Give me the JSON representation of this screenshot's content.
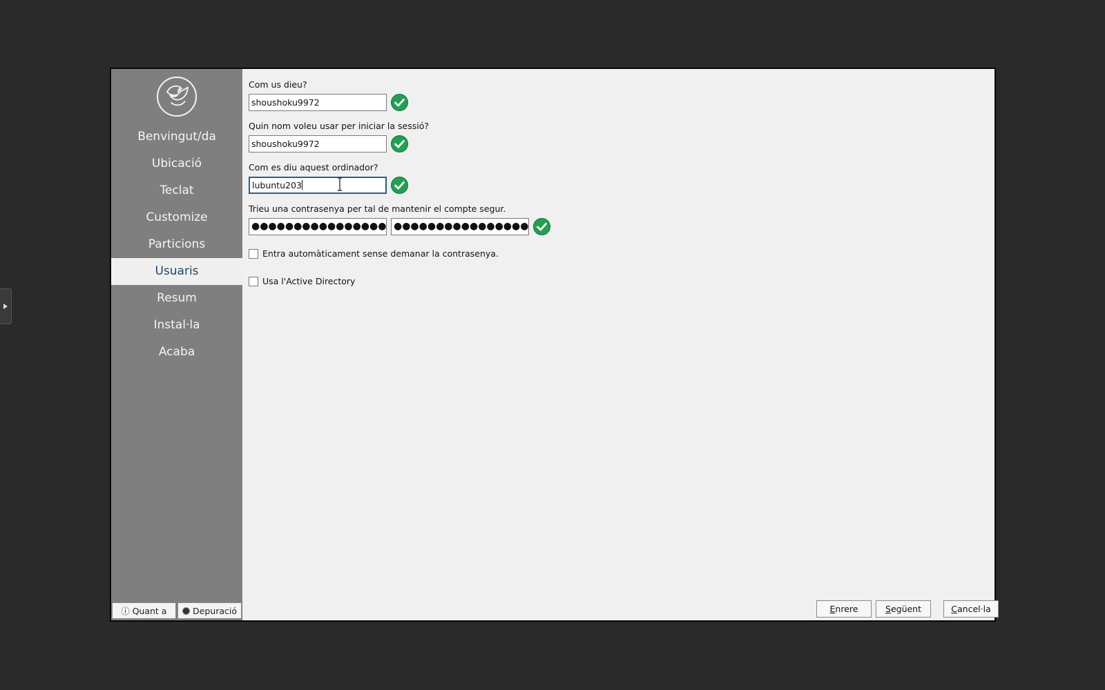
{
  "sidebar": {
    "items": [
      {
        "label": "Benvingut/da"
      },
      {
        "label": "Ubicació"
      },
      {
        "label": "Teclat"
      },
      {
        "label": "Customize"
      },
      {
        "label": "Particions"
      },
      {
        "label": "Usuaris",
        "active": true
      },
      {
        "label": "Resum"
      },
      {
        "label": "Instal·la"
      },
      {
        "label": "Acaba"
      }
    ],
    "about_label": "Quant a",
    "debug_label": "Depuració"
  },
  "form": {
    "name_label": "Com us dieu?",
    "name_value": "shoushoku9972",
    "login_label": "Quin nom voleu usar per iniciar la sessió?",
    "login_value": "shoushoku9972",
    "hostname_label": "Com es diu aquest ordinador?",
    "hostname_value": "lubuntu203",
    "password_label": "Trieu una contrasenya per tal de mantenir el compte segur.",
    "password_mask": "●●●●●●●●●●●●●●●●",
    "password_confirm_mask": "●●●●●●●●●●●●●●●●",
    "autologin_label": "Entra automàticament sense demanar la contrasenya.",
    "autologin_checked": false,
    "active_directory_label": "Usa l'Active Directory",
    "active_directory_checked": false
  },
  "buttons": {
    "back_accel": "E",
    "back_rest": "nrere",
    "next_accel": "S",
    "next_rest": "egüent",
    "cancel_accel": "C",
    "cancel_rest": "ancel·la"
  },
  "colors": {
    "sidebar_bg": "#7f7f7f",
    "active_text": "#19466c",
    "ok_green": "#21a152",
    "content_bg": "#f0f0f0"
  }
}
